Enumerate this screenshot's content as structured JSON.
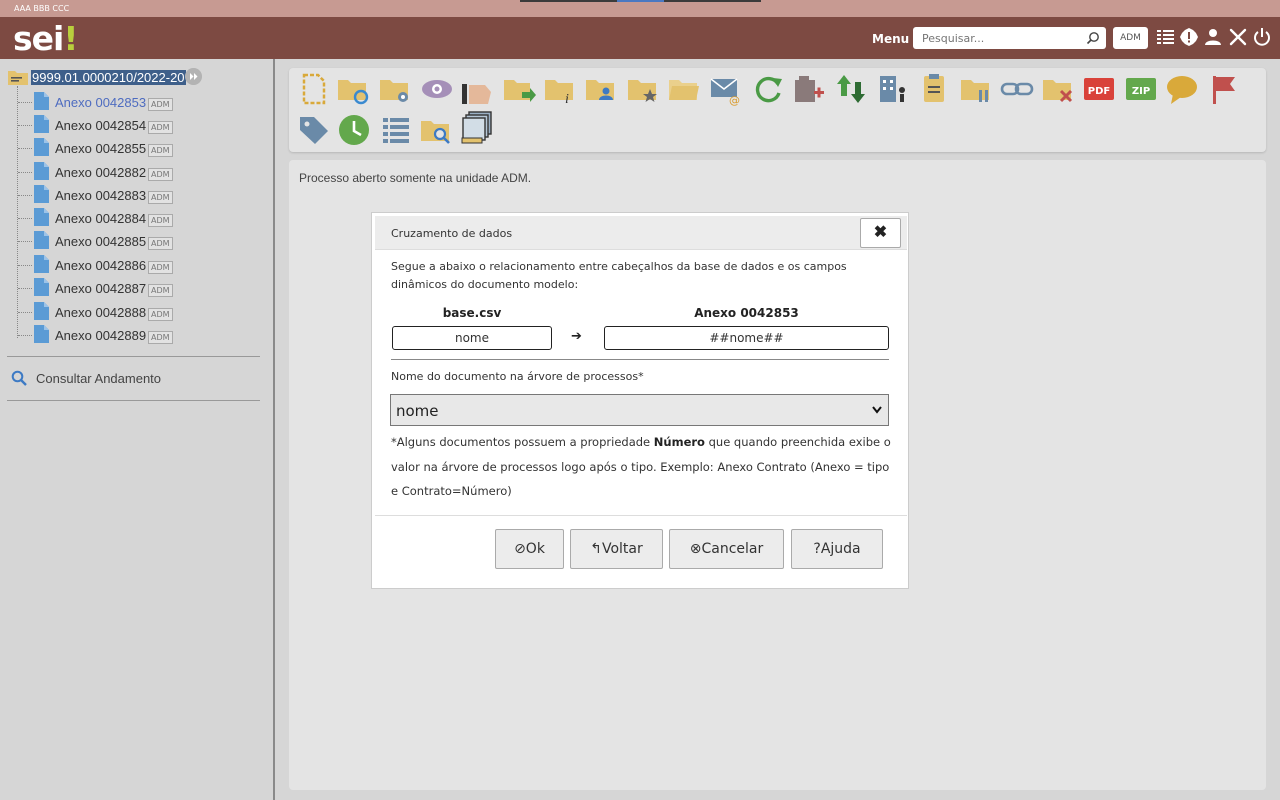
{
  "topbar": {
    "org_label": "AAA BBB CCC"
  },
  "header": {
    "logo_text": "sei",
    "logo_mark": "!",
    "menu_label": "Menu",
    "search_placeholder": "Pesquisar...",
    "unit_label": "ADM",
    "icons": [
      "list-icon",
      "alert-icon",
      "user-icon",
      "tools-icon",
      "power-icon"
    ]
  },
  "tree": {
    "root_label": "9999.01.0000210/2022-20",
    "items": [
      {
        "label": "Anexo 0042853",
        "badge": "ADM",
        "active": true
      },
      {
        "label": "Anexo 0042854",
        "badge": "ADM"
      },
      {
        "label": "Anexo 0042855",
        "badge": "ADM"
      },
      {
        "label": "Anexo 0042882",
        "badge": "ADM"
      },
      {
        "label": "Anexo 0042883",
        "badge": "ADM"
      },
      {
        "label": "Anexo 0042884",
        "badge": "ADM"
      },
      {
        "label": "Anexo 0042885",
        "badge": "ADM"
      },
      {
        "label": "Anexo 0042886",
        "badge": "ADM"
      },
      {
        "label": "Anexo 0042887",
        "badge": "ADM"
      },
      {
        "label": "Anexo 0042888",
        "badge": "ADM"
      },
      {
        "label": "Anexo 0042889",
        "badge": "ADM"
      }
    ],
    "consult_label": "Consultar Andamento"
  },
  "content": {
    "message": "Processo aberto somente na unidade ADM."
  },
  "modal": {
    "title": "Cruzamento de dados",
    "description": "Segue a abaixo o relacionamento entre cabeçalhos da base de dados e os campos dinâmicos do documento modelo:",
    "left_header": "base.csv",
    "right_header": "Anexo 0042853",
    "left_value": "nome",
    "arrow": "➔",
    "right_value": "##nome##",
    "name_label": "Nome do documento na árvore de processos*",
    "name_value": "nome",
    "note_pre": "*Alguns documentos possuem a propriedade ",
    "note_bold": "Número",
    "note_post": " que quando preenchida exibe o valor na árvore de processos logo após o tipo. Exemplo: Anexo Contrato (Anexo = tipo e Contrato=Número)",
    "close_symbol": "✖",
    "buttons": {
      "ok": "Ok",
      "back": "Voltar",
      "cancel": "Cancelar",
      "help": "Ajuda"
    },
    "button_glyphs": {
      "ok": "⊘",
      "back": "↰",
      "cancel": "⊗",
      "help": "?"
    }
  },
  "colors": {
    "header_bg": "#7d4a42",
    "top_strip": "#c79a92",
    "logo_accent": "#b9cf3d",
    "tree_selected_bg": "#3e5f8a",
    "link_active": "#4e6cc0"
  }
}
